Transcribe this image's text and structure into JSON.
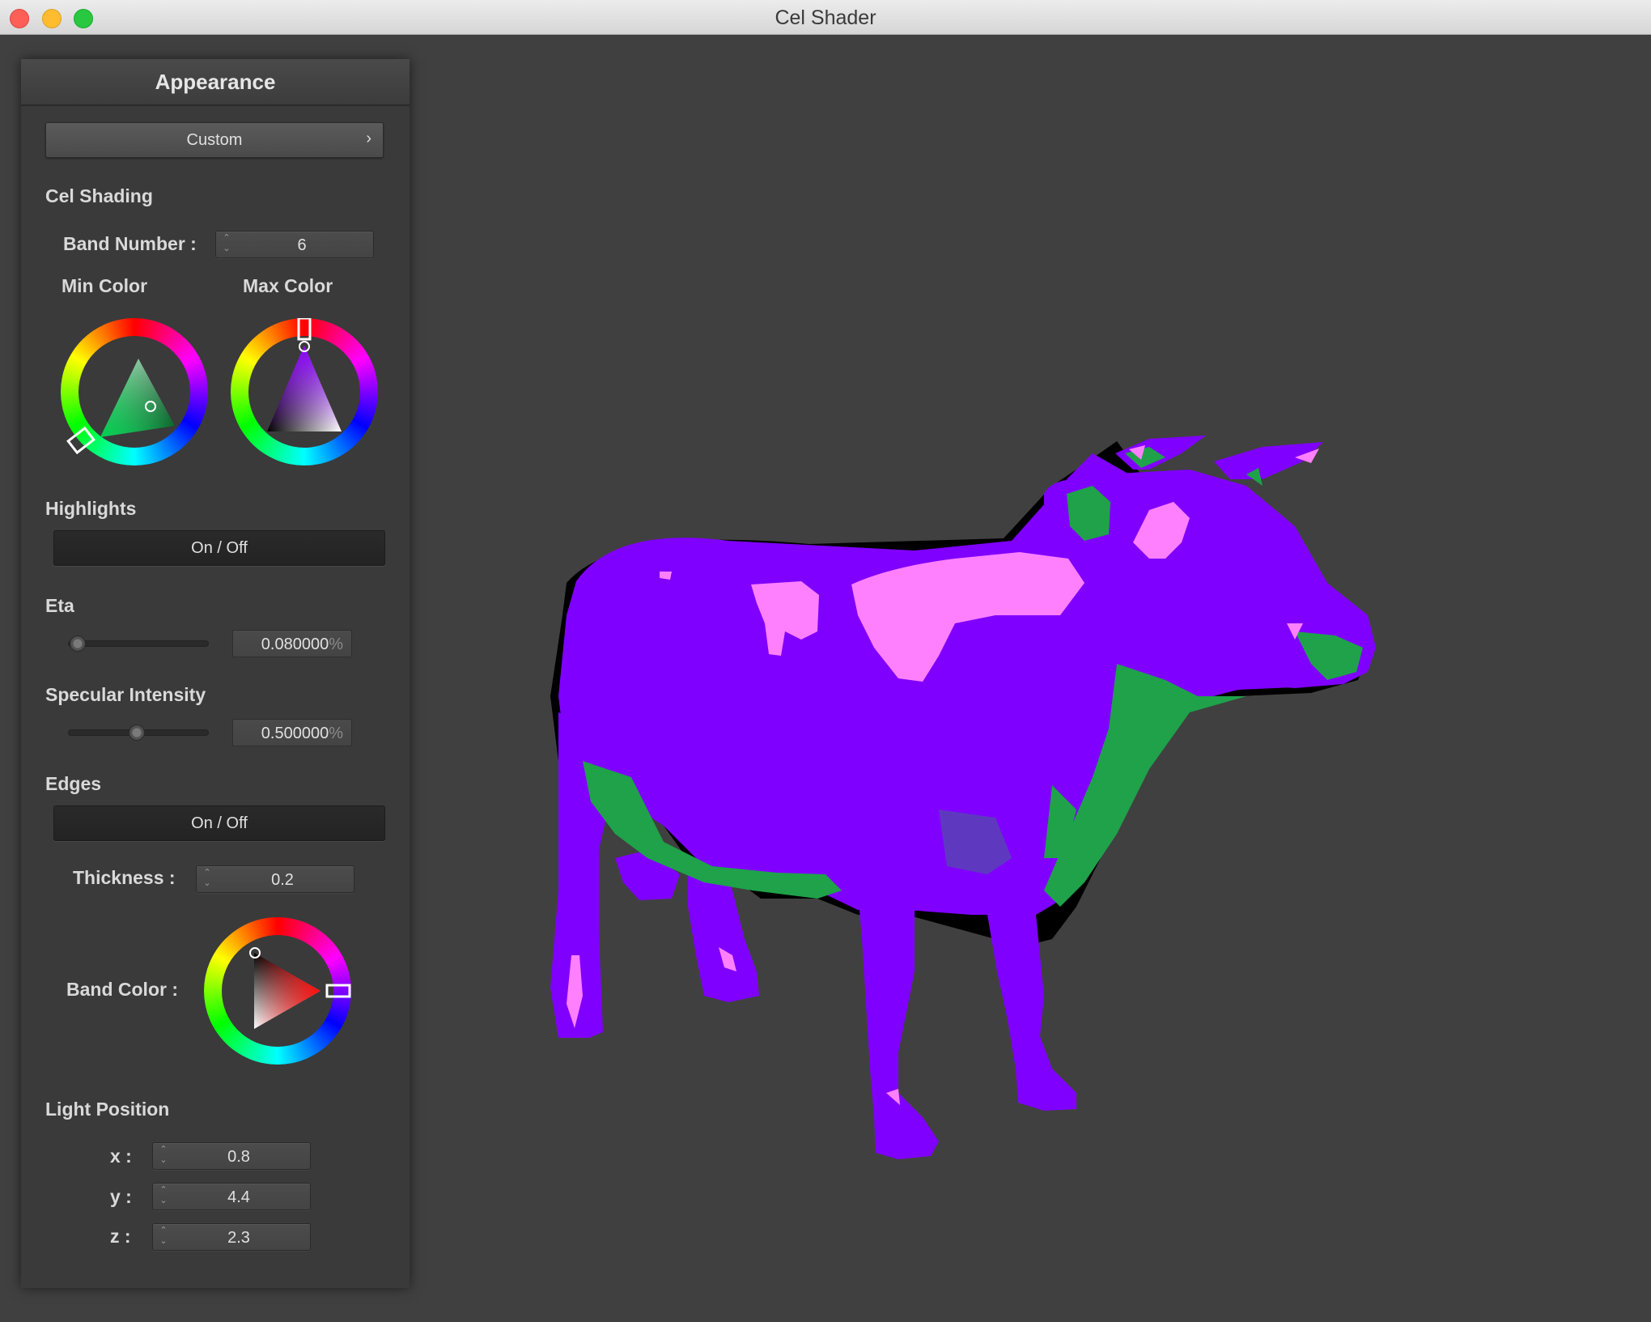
{
  "window": {
    "title": "Cel Shader"
  },
  "panel": {
    "title": "Appearance",
    "preset": {
      "label": "Custom",
      "arrow": "›"
    },
    "cel_shading": {
      "heading": "Cel Shading",
      "band_number_label": "Band Number :",
      "band_number_value": "6",
      "min_color_label": "Min Color",
      "max_color_label": "Max Color",
      "min_color": "#2ea84a",
      "max_color": "#8b00ff"
    },
    "highlights": {
      "heading": "Highlights",
      "toggle_label": "On / Off"
    },
    "eta": {
      "heading": "Eta",
      "value": "0.080000",
      "unit": "%",
      "fraction": 0.08
    },
    "specular": {
      "heading": "Specular Intensity",
      "value": "0.500000",
      "unit": "%",
      "fraction": 0.5
    },
    "edges": {
      "heading": "Edges",
      "toggle_label": "On / Off",
      "thickness_label": "Thickness :",
      "thickness_value": "0.2",
      "band_color_label": "Band Color :",
      "band_color": "#ff0000"
    },
    "light": {
      "heading": "Light Position",
      "x_label": "x :",
      "x_value": "0.8",
      "y_label": "y :",
      "y_value": "4.4",
      "z_label": "z :",
      "z_value": "2.3"
    }
  },
  "viewport": {
    "model": "cow",
    "colors": {
      "base": "#8000ff",
      "highlight": "#ff80ff",
      "shadow": "#1fa24a",
      "outline": "#000000"
    }
  }
}
